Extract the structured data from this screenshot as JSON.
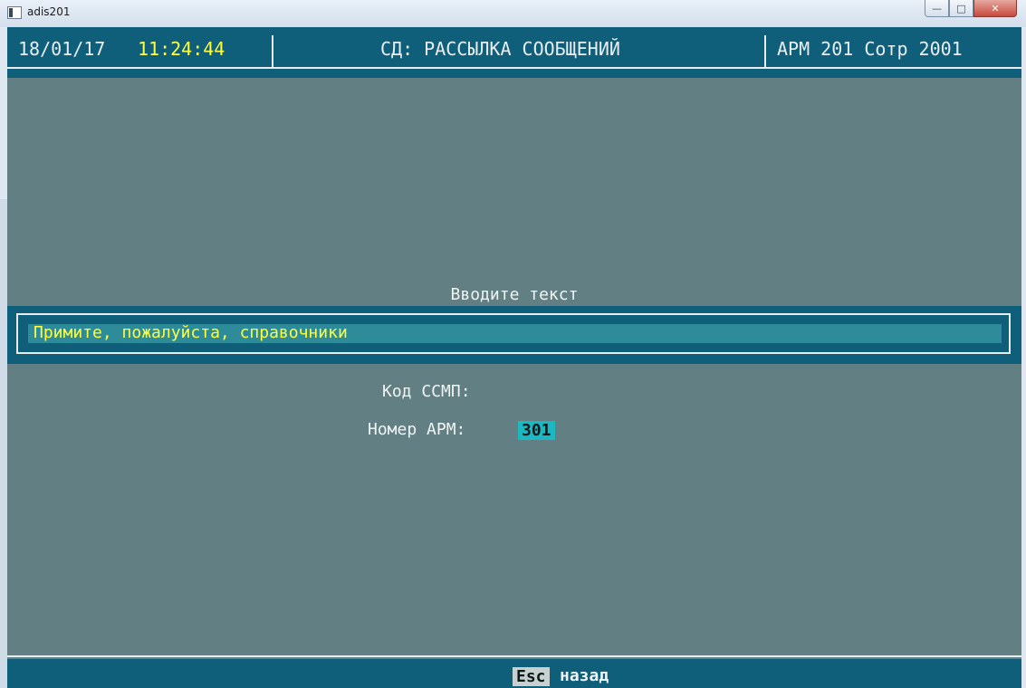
{
  "window": {
    "title": "adis201"
  },
  "status": {
    "date": "18/01/17",
    "time": "11:24:44",
    "title": "СД: РАССЫЛКА СООБЩЕНИЙ",
    "station": "АРМ 201 Сотр 2001"
  },
  "form": {
    "prompt": "Вводите текст",
    "message": "Примите, пожалуйста, справочники",
    "code_label": "Код ССМП:",
    "code_value": "",
    "arm_label": "Номер АРМ:",
    "arm_value": "301"
  },
  "footer": {
    "key": "Esc",
    "label": "назад"
  },
  "colors": {
    "background": "#628083",
    "bar": "#0f5f7a",
    "input": "#2e8c9a",
    "accent_text": "#ffff40",
    "highlight": "#1bb8c2"
  }
}
